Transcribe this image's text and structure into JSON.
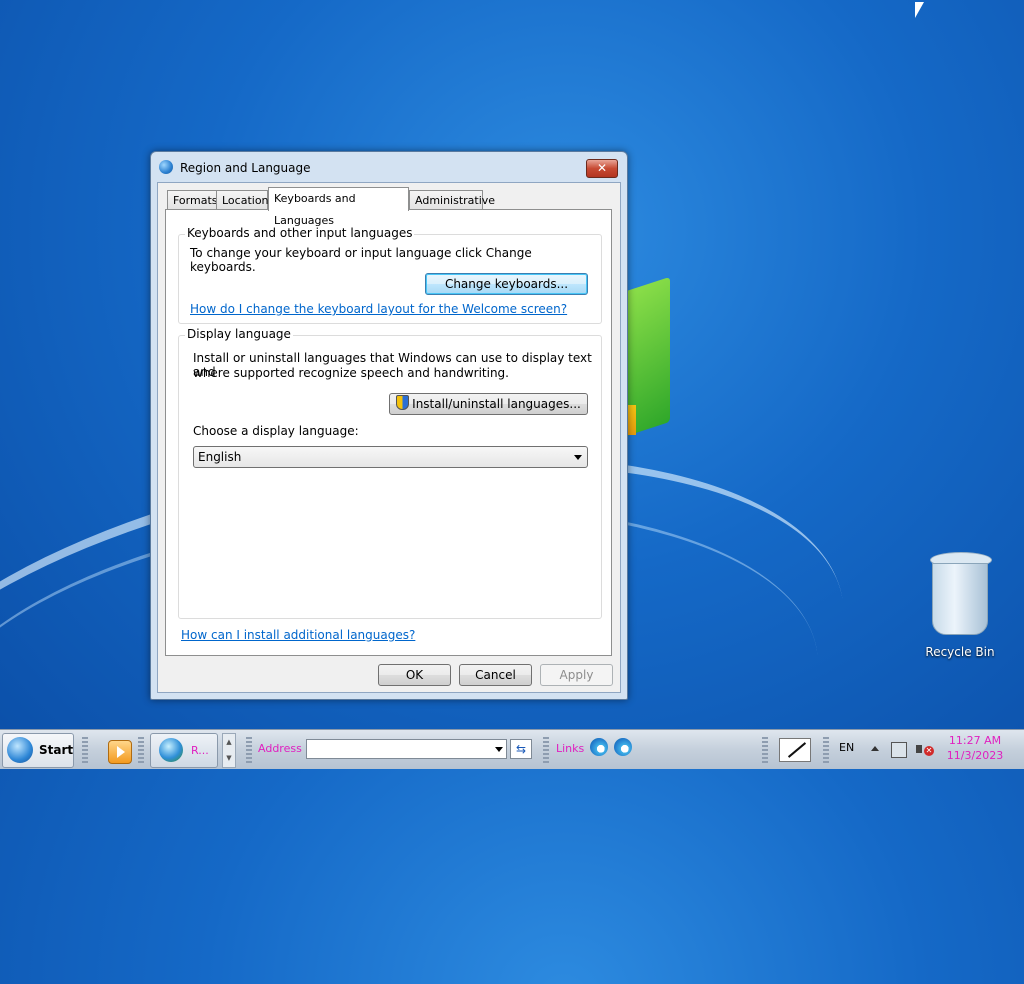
{
  "dialog": {
    "title": "Region and Language",
    "close_glyph": "✕",
    "tabs": [
      {
        "label": "Formats"
      },
      {
        "label": "Location"
      },
      {
        "label": "Keyboards and Languages"
      },
      {
        "label": "Administrative"
      }
    ],
    "active_tab": "Keyboards and Languages",
    "keyboards_group": {
      "title": "Keyboards and other input languages",
      "description": "To change your keyboard or input language click Change keyboards.",
      "change_button": "Change keyboards...",
      "welcome_link": "How do I change the keyboard layout for the Welcome screen?"
    },
    "display_group": {
      "title": "Display language",
      "description_line1": "Install or uninstall languages that Windows can use to display text and",
      "description_line2": "where supported recognize speech and handwriting.",
      "install_button": "Install/uninstall languages...",
      "choose_label": "Choose a display language:",
      "selected_language": "English"
    },
    "additional_link": "How can I install additional languages?",
    "buttons": {
      "ok": "OK",
      "cancel": "Cancel",
      "apply": "Apply"
    }
  },
  "desktop": {
    "recycle_bin_label": "Recycle Bin"
  },
  "taskbar": {
    "start_label": "Start",
    "task_label": "R...",
    "address_label": "Address",
    "address_value": "",
    "go_glyph": "⇆",
    "links_label": "Links",
    "language": "EN",
    "clock_time": "11:27 AM",
    "clock_date": "11/3/2023"
  },
  "colors": {
    "link": "#0066cc",
    "taskbar_text": "#e020c0",
    "close_button": "#c74a33"
  }
}
